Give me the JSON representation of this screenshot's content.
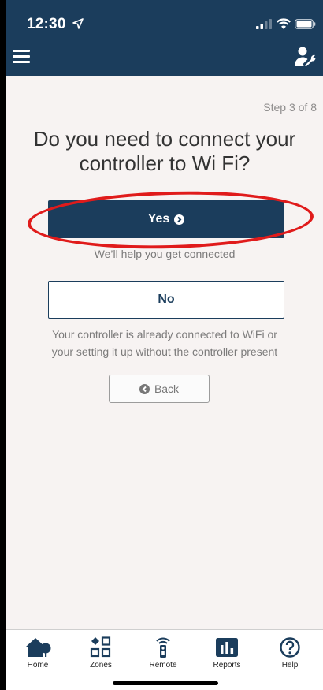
{
  "status_bar": {
    "time": "12:30"
  },
  "header": {
    "menu_icon": "hamburger-icon",
    "account_icon": "user-wrench-icon"
  },
  "wizard": {
    "step": "Step 3 of 8",
    "question": "Do you need to connect your controller to Wi Fi?",
    "yes_label": "Yes",
    "yes_subtext": "We’ll help you get connected",
    "no_label": "No",
    "no_subtext_line1": "Your controller is already connected to WiFi or",
    "no_subtext_line2": "your setting it up without the controller present",
    "back_label": "Back"
  },
  "tabs": [
    {
      "label": "Home",
      "icon": "home-icon"
    },
    {
      "label": "Zones",
      "icon": "zones-icon"
    },
    {
      "label": "Remote",
      "icon": "remote-icon"
    },
    {
      "label": "Reports",
      "icon": "reports-icon"
    },
    {
      "label": "Help",
      "icon": "help-icon"
    }
  ],
  "colors": {
    "primary": "#1b3d5c",
    "background": "#f7f3f2",
    "annotation": "#e01b1b"
  }
}
